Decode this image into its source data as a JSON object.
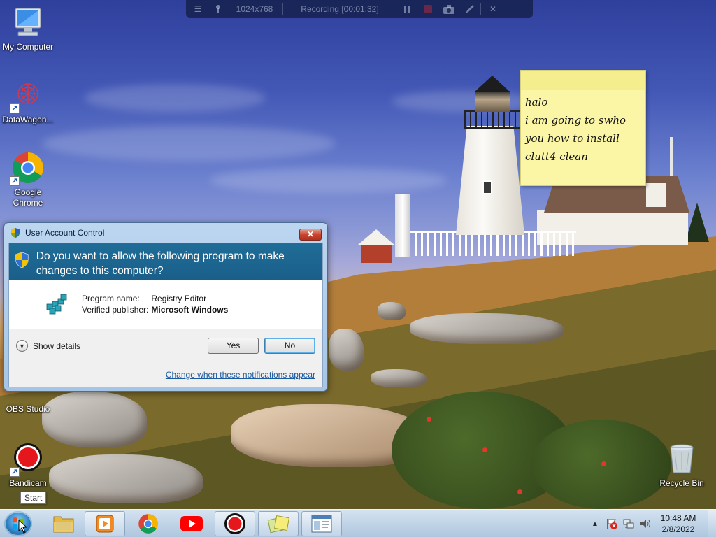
{
  "recorder": {
    "resolution": "1024x768",
    "status": "Recording [00:01:32]"
  },
  "desktop_icons": {
    "my_computer": "My Computer",
    "datawagon": "DataWagon...",
    "chrome_line1": "Google",
    "chrome_line2": "Chrome",
    "obs": "OBS Studio",
    "bandicam": "Bandicam",
    "recycle_bin": "Recycle Bin"
  },
  "sticky_note": {
    "line1": "halo",
    "line2": "i am going to swho",
    "line3": "you how to install",
    "line4": "clutt4 clean"
  },
  "uac": {
    "title": "User Account Control",
    "question": "Do you want to allow the following program to make changes to this computer?",
    "program_name_label": "Program name:",
    "program_name": "Registry Editor",
    "publisher_label": "Verified publisher:",
    "publisher": "Microsoft Windows",
    "show_details": "Show details",
    "yes": "Yes",
    "no": "No",
    "notifications_link": "Change when these notifications appear",
    "close_glyph": "✕"
  },
  "taskbar": {
    "start_tooltip": "Start",
    "time": "10:48 AM",
    "date": "2/8/2022",
    "pinned": [
      "windows-explorer",
      "media-player",
      "google-chrome",
      "youtube",
      "bandicam",
      "sticky-notes",
      "registry-editor"
    ]
  }
}
